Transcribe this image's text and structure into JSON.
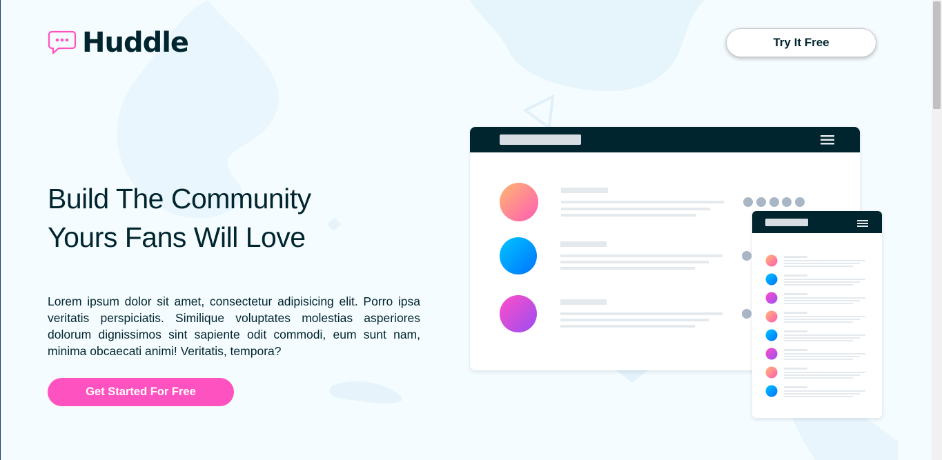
{
  "brand": {
    "name": "Huddle",
    "icon": "chat-bubble-icon"
  },
  "header": {
    "cta_label": "Try It Free"
  },
  "hero": {
    "title_line1": "Build The Community",
    "title_line2": "Yours Fans Will Love",
    "body": "Lorem ipsum dolor sit amet, consectetur adipisicing elit. Porro ipsa veritatis perspiciatis. Similique voluptates molestias asperiores dolorum dignissimos sint sapiente odit commodi, eum sunt nam, minima obcaecati animi! Veritatis, tempora?",
    "cta_label": "Get Started For Free"
  },
  "colors": {
    "dark": "#00252e",
    "pink": "#ff52c1",
    "background": "#f5fcff"
  }
}
